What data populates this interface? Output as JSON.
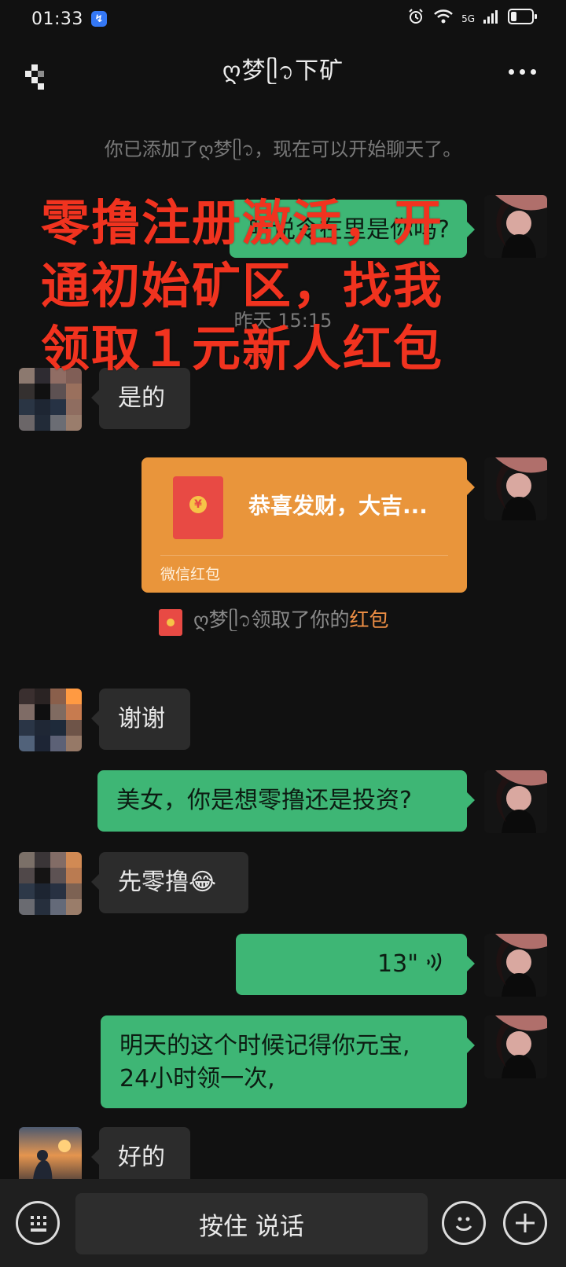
{
  "status_bar": {
    "time": "01:33",
    "network": "5G"
  },
  "header": {
    "title": "ღ梦ᥫ᭡下矿"
  },
  "messages": {
    "added_notice": "你已添加了ღ梦ᥫ᭡，现在可以开始聊天了。",
    "m1": "听说令在里是你吗?",
    "timestamp": "昨天 15:15",
    "m2": "是的",
    "redpacket_title": "恭喜发财，大吉...",
    "redpacket_label": "微信红包",
    "claim_prefix": "ღ梦ᥫ᭡领取了你的",
    "claim_link": "红包",
    "m3": "谢谢",
    "m4": "美女，你是想零撸还是投资?",
    "m5": "先零撸😂",
    "voice_duration": "13\"",
    "m6_line1": "明天的这个时候记得你元宝,",
    "m6_line2": "24小时领一次,",
    "m7": "好的"
  },
  "overlay": {
    "line1": "零撸注册激活，开",
    "line2": "通初始矿区，找我",
    "line3": "领取１元新人红包"
  },
  "bottom_bar": {
    "hold_to_talk": "按住 说话"
  },
  "colors": {
    "green_bubble": "#3eb675",
    "gray_bubble": "#2c2c2c",
    "redpacket": "#e9953b",
    "overlay_red": "#f1331f"
  }
}
